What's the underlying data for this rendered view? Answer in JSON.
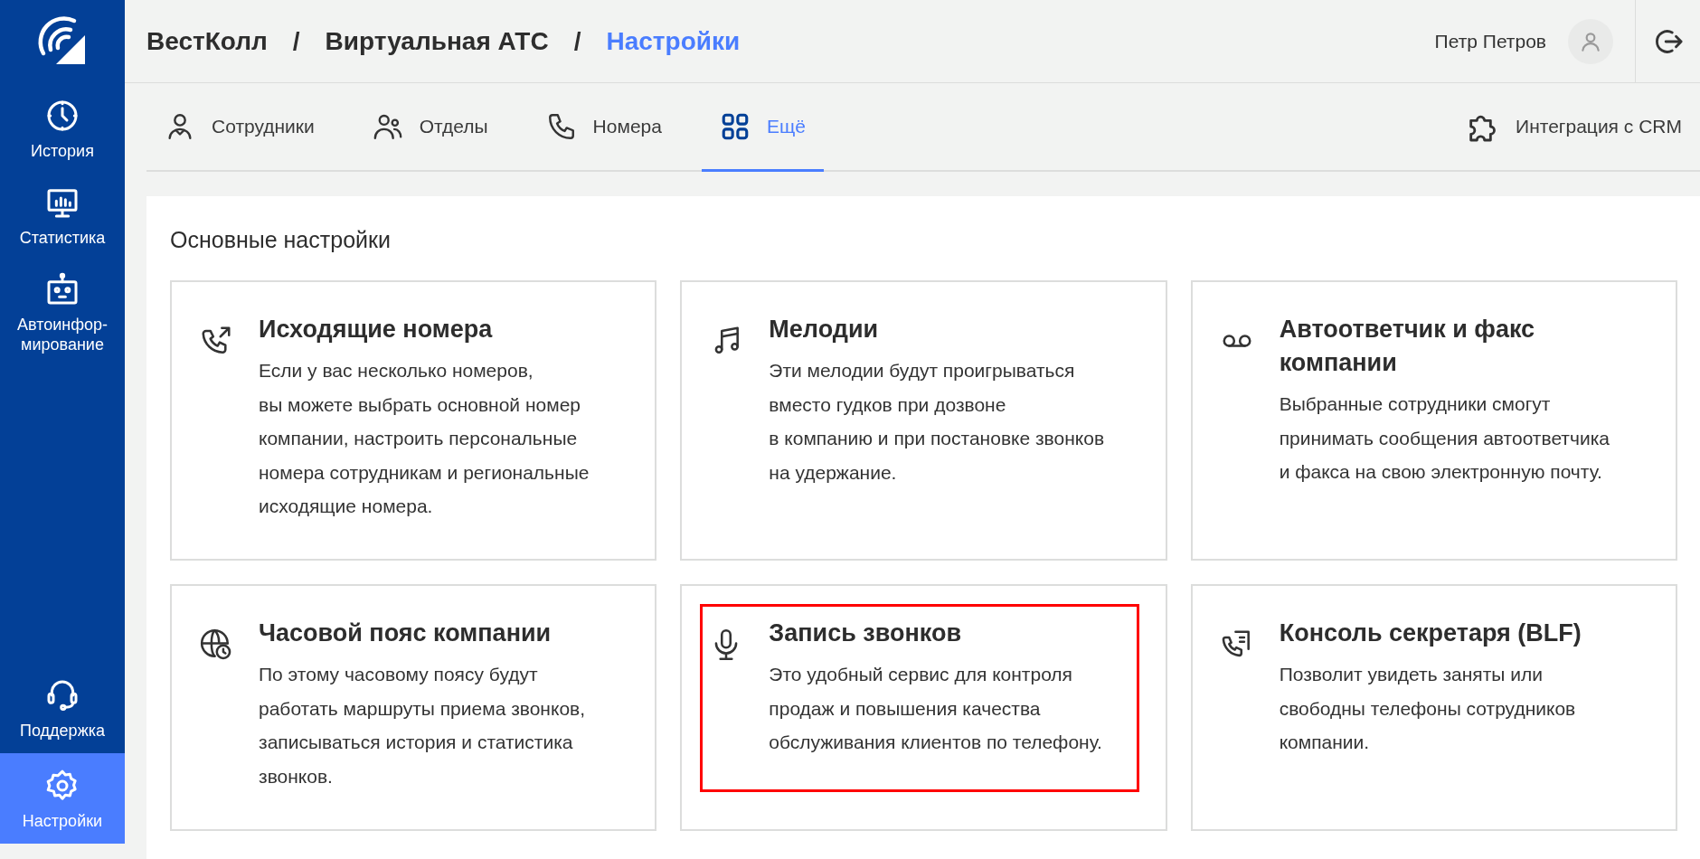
{
  "sidebar": {
    "items": [
      {
        "kind": "history",
        "label": "История",
        "selected": false
      },
      {
        "kind": "stats",
        "label": "Статистика",
        "selected": false
      },
      {
        "kind": "robot",
        "label": "Автоинфор-\nмирование",
        "selected": false
      }
    ],
    "bottom_items": [
      {
        "kind": "support",
        "label": "Поддержка",
        "selected": false
      },
      {
        "kind": "settings",
        "label": "Настройки",
        "selected": true
      }
    ]
  },
  "breadcrumbs": [
    {
      "label": "ВестКолл",
      "current": false
    },
    {
      "label": "Виртуальная АТС",
      "current": false
    },
    {
      "label": "Настройки",
      "current": true
    }
  ],
  "breadcrumb_separator": "/",
  "user": {
    "name": "Петр Петров"
  },
  "tabs": [
    {
      "kind": "person",
      "label": "Сотрудники",
      "selected": false
    },
    {
      "kind": "people",
      "label": "Отделы",
      "selected": false
    },
    {
      "kind": "phone",
      "label": "Номера",
      "selected": false
    },
    {
      "kind": "grid",
      "label": "Ещё",
      "selected": true
    }
  ],
  "integration_button": {
    "label": "Интеграция с CRM"
  },
  "section": {
    "title": "Основные настройки",
    "cards": [
      {
        "kind": "outgoing",
        "title": "Исходящие номера",
        "description": [
          "Если у вас несколько номеров,",
          "вы можете выбрать основной номер",
          "компании, настроить персональные",
          "номера сотрудникам и региональные",
          "исходящие номера."
        ],
        "highlighted": false
      },
      {
        "kind": "music",
        "title": "Мелодии",
        "description": [
          "Эти мелодии будут проигрываться",
          "вместо гудков при дозвоне",
          "в компанию и при постановке звонков",
          "на удержание."
        ],
        "highlighted": false
      },
      {
        "kind": "voicemail",
        "title": "Автоответчик и факс компании",
        "description": [
          "Выбранные сотрудники смогут",
          "принимать сообщения автоответчика",
          "и факса на свою электронную почту."
        ],
        "highlighted": false
      },
      {
        "kind": "timezone",
        "title": "Часовой пояс компании",
        "description": [
          "По этому часовому поясу будут",
          "работать маршруты приема звонков,",
          "записываться история и статистика",
          "звонков."
        ],
        "highlighted": false
      },
      {
        "kind": "mic",
        "title": "Запись звонков",
        "description": [
          "Это удобный сервис для контроля",
          "продаж и повышения качества",
          "обслуживания клиентов по телефону."
        ],
        "highlighted": true
      },
      {
        "kind": "blf",
        "title": "Консоль секретаря (BLF)",
        "description": [
          "Позволит увидеть заняты или",
          "свободны телефоны сотрудников",
          "компании."
        ],
        "highlighted": false
      }
    ]
  }
}
